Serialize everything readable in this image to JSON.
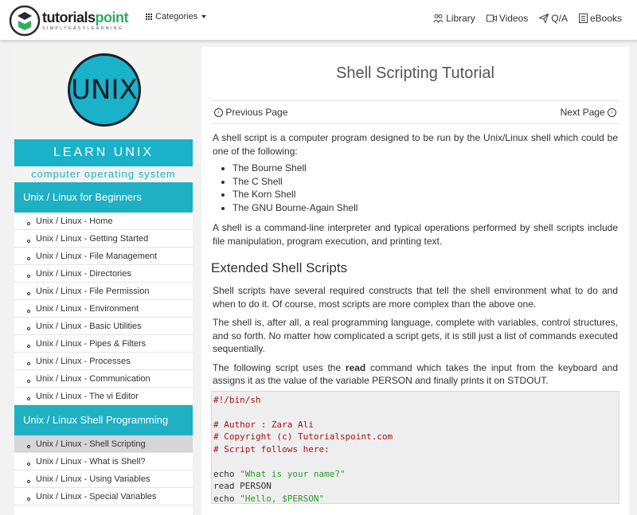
{
  "header": {
    "logo_main_dark": "tutorials",
    "logo_main_green": "point",
    "logo_tagline": "SIMPLYEASYLEARNING",
    "categories_label": "Categories",
    "nav": [
      {
        "label": "Library",
        "icon": "library-icon"
      },
      {
        "label": "Videos",
        "icon": "video-icon"
      },
      {
        "label": "Q/A",
        "icon": "send-icon"
      },
      {
        "label": "eBooks",
        "icon": "book-icon"
      }
    ]
  },
  "sidebar": {
    "banner_logo": "UNIX",
    "banner_learn": "LEARN UNIX",
    "banner_subtitle": "computer operating system",
    "section1_title": "Unix / Linux for Beginners",
    "section1_items": [
      "Unix / Linux - Home",
      "Unix / Linux - Getting Started",
      "Unix / Linux - File Management",
      "Unix / Linux - Directories",
      "Unix / Linux - File Permission",
      "Unix / Linux - Environment",
      "Unix / Linux - Basic Utilities",
      "Unix / Linux - Pipes & Filters",
      "Unix / Linux - Processes",
      "Unix / Linux - Communication",
      "Unix / Linux - The vi Editor"
    ],
    "section2_title": "Unix / Linux Shell Programming",
    "section2_items": [
      "Unix / Linux - Shell Scripting",
      "Unix / Linux - What is Shell?",
      "Unix / Linux - Using Variables",
      "Unix / Linux - Special Variables"
    ]
  },
  "content": {
    "title": "Shell Scripting Tutorial",
    "prev_label": "Previous Page",
    "next_label": "Next Page",
    "intro": "A shell script is a computer program designed to be run by the Unix/Linux shell which could be one of the following:",
    "shells": [
      "The Bourne Shell",
      "The C Shell",
      "The Korn Shell",
      "The GNU Bourne-Again Shell"
    ],
    "para2": "A shell is a command-line interpreter and typical operations performed by shell scripts include file manipulation, program execution, and printing text.",
    "heading2": "Extended Shell Scripts",
    "para3": "Shell scripts have several required constructs that tell the shell environment what to do and when to do it. Of course, most scripts are more complex than the above one.",
    "para4": "The shell is, after all, a real programming language, complete with variables, control structures, and so forth. No matter how complicated a script gets, it is still just a list of commands executed sequentially.",
    "para5_before": "The following script uses the ",
    "para5_bold": "read",
    "para5_after": " command which takes the input from the keyboard and assigns it as the value of the variable PERSON and finally prints it on STDOUT.",
    "code": {
      "shebang": "#!/bin/sh",
      "c1": "# Author : Zara Ali",
      "c2": "# Copyright (c) Tutorialspoint.com",
      "c3": "# Script follows here:",
      "l1_cmd": "echo ",
      "l1_str": "\"What is your name?\"",
      "l2": "read PERSON",
      "l3_cmd": "echo ",
      "l3_str": "\"Hello, $PERSON\""
    }
  }
}
